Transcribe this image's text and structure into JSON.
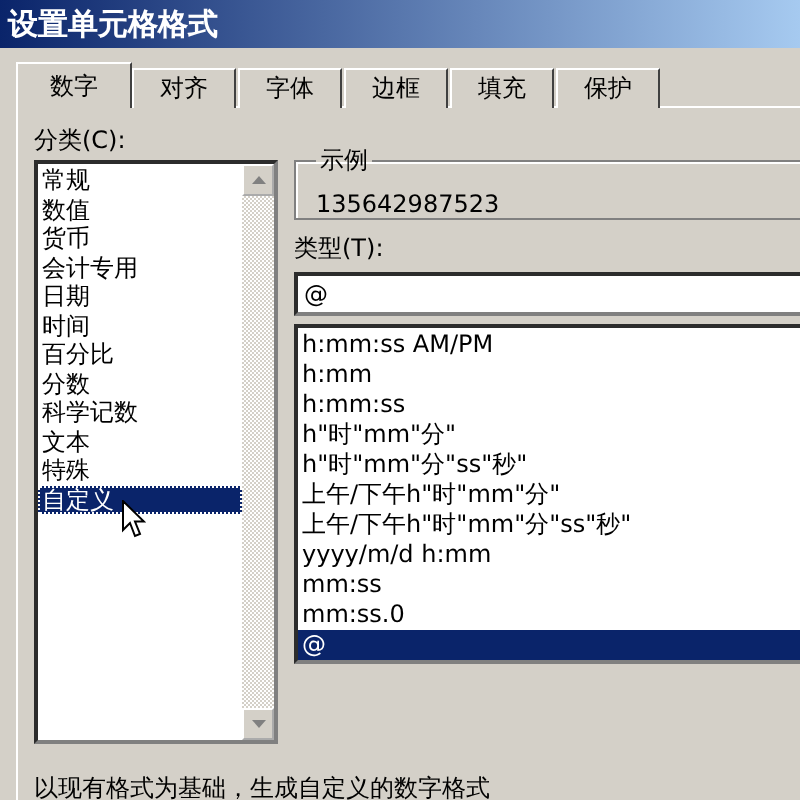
{
  "window": {
    "title": "设置单元格格式"
  },
  "tabs": [
    {
      "label": "数字",
      "selected": true
    },
    {
      "label": "对齐",
      "selected": false
    },
    {
      "label": "字体",
      "selected": false
    },
    {
      "label": "边框",
      "selected": false
    },
    {
      "label": "填充",
      "selected": false
    },
    {
      "label": "保护",
      "selected": false
    }
  ],
  "category": {
    "label": "分类(C):",
    "items": [
      {
        "label": "常规",
        "selected": false
      },
      {
        "label": "数值",
        "selected": false
      },
      {
        "label": "货币",
        "selected": false
      },
      {
        "label": "会计专用",
        "selected": false
      },
      {
        "label": "日期",
        "selected": false
      },
      {
        "label": "时间",
        "selected": false
      },
      {
        "label": "百分比",
        "selected": false
      },
      {
        "label": "分数",
        "selected": false
      },
      {
        "label": "科学记数",
        "selected": false
      },
      {
        "label": "文本",
        "selected": false
      },
      {
        "label": "特殊",
        "selected": false
      },
      {
        "label": "自定义",
        "selected": true
      }
    ]
  },
  "sample": {
    "label": "示例",
    "value": "135642987523"
  },
  "type": {
    "label": "类型(T):",
    "value": "@",
    "items": [
      {
        "label": "h:mm:ss AM/PM",
        "selected": false
      },
      {
        "label": "h:mm",
        "selected": false
      },
      {
        "label": "h:mm:ss",
        "selected": false
      },
      {
        "label": "h\"时\"mm\"分\"",
        "selected": false
      },
      {
        "label": "h\"时\"mm\"分\"ss\"秒\"",
        "selected": false
      },
      {
        "label": "上午/下午h\"时\"mm\"分\"",
        "selected": false
      },
      {
        "label": "上午/下午h\"时\"mm\"分\"ss\"秒\"",
        "selected": false
      },
      {
        "label": "yyyy/m/d h:mm",
        "selected": false
      },
      {
        "label": "mm:ss",
        "selected": false
      },
      {
        "label": "mm:ss.0",
        "selected": false
      },
      {
        "label": "@",
        "selected": true
      }
    ]
  },
  "description": "以现有格式为基础，生成自定义的数字格式"
}
